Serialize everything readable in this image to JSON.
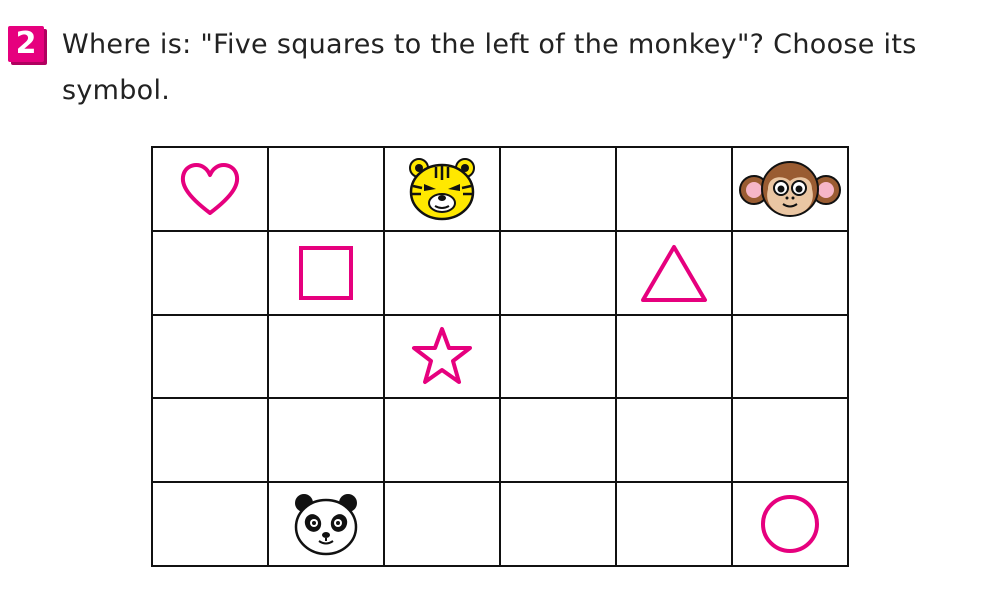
{
  "question": {
    "number": "2",
    "text": "Where is: \"Five squares to the left of the monkey\"? Choose its symbol."
  },
  "grid": {
    "rows": 5,
    "cols": 6,
    "accent_color": "#e6007e",
    "cells": [
      [
        "heart-icon",
        "",
        "tiger-icon",
        "",
        "",
        "monkey-icon"
      ],
      [
        "",
        "square-icon",
        "",
        "",
        "triangle-icon",
        ""
      ],
      [
        "",
        "",
        "star-icon",
        "",
        "",
        ""
      ],
      [
        "",
        "",
        "",
        "",
        "",
        ""
      ],
      [
        "",
        "panda-icon",
        "",
        "",
        "",
        "circle-icon"
      ]
    ]
  }
}
